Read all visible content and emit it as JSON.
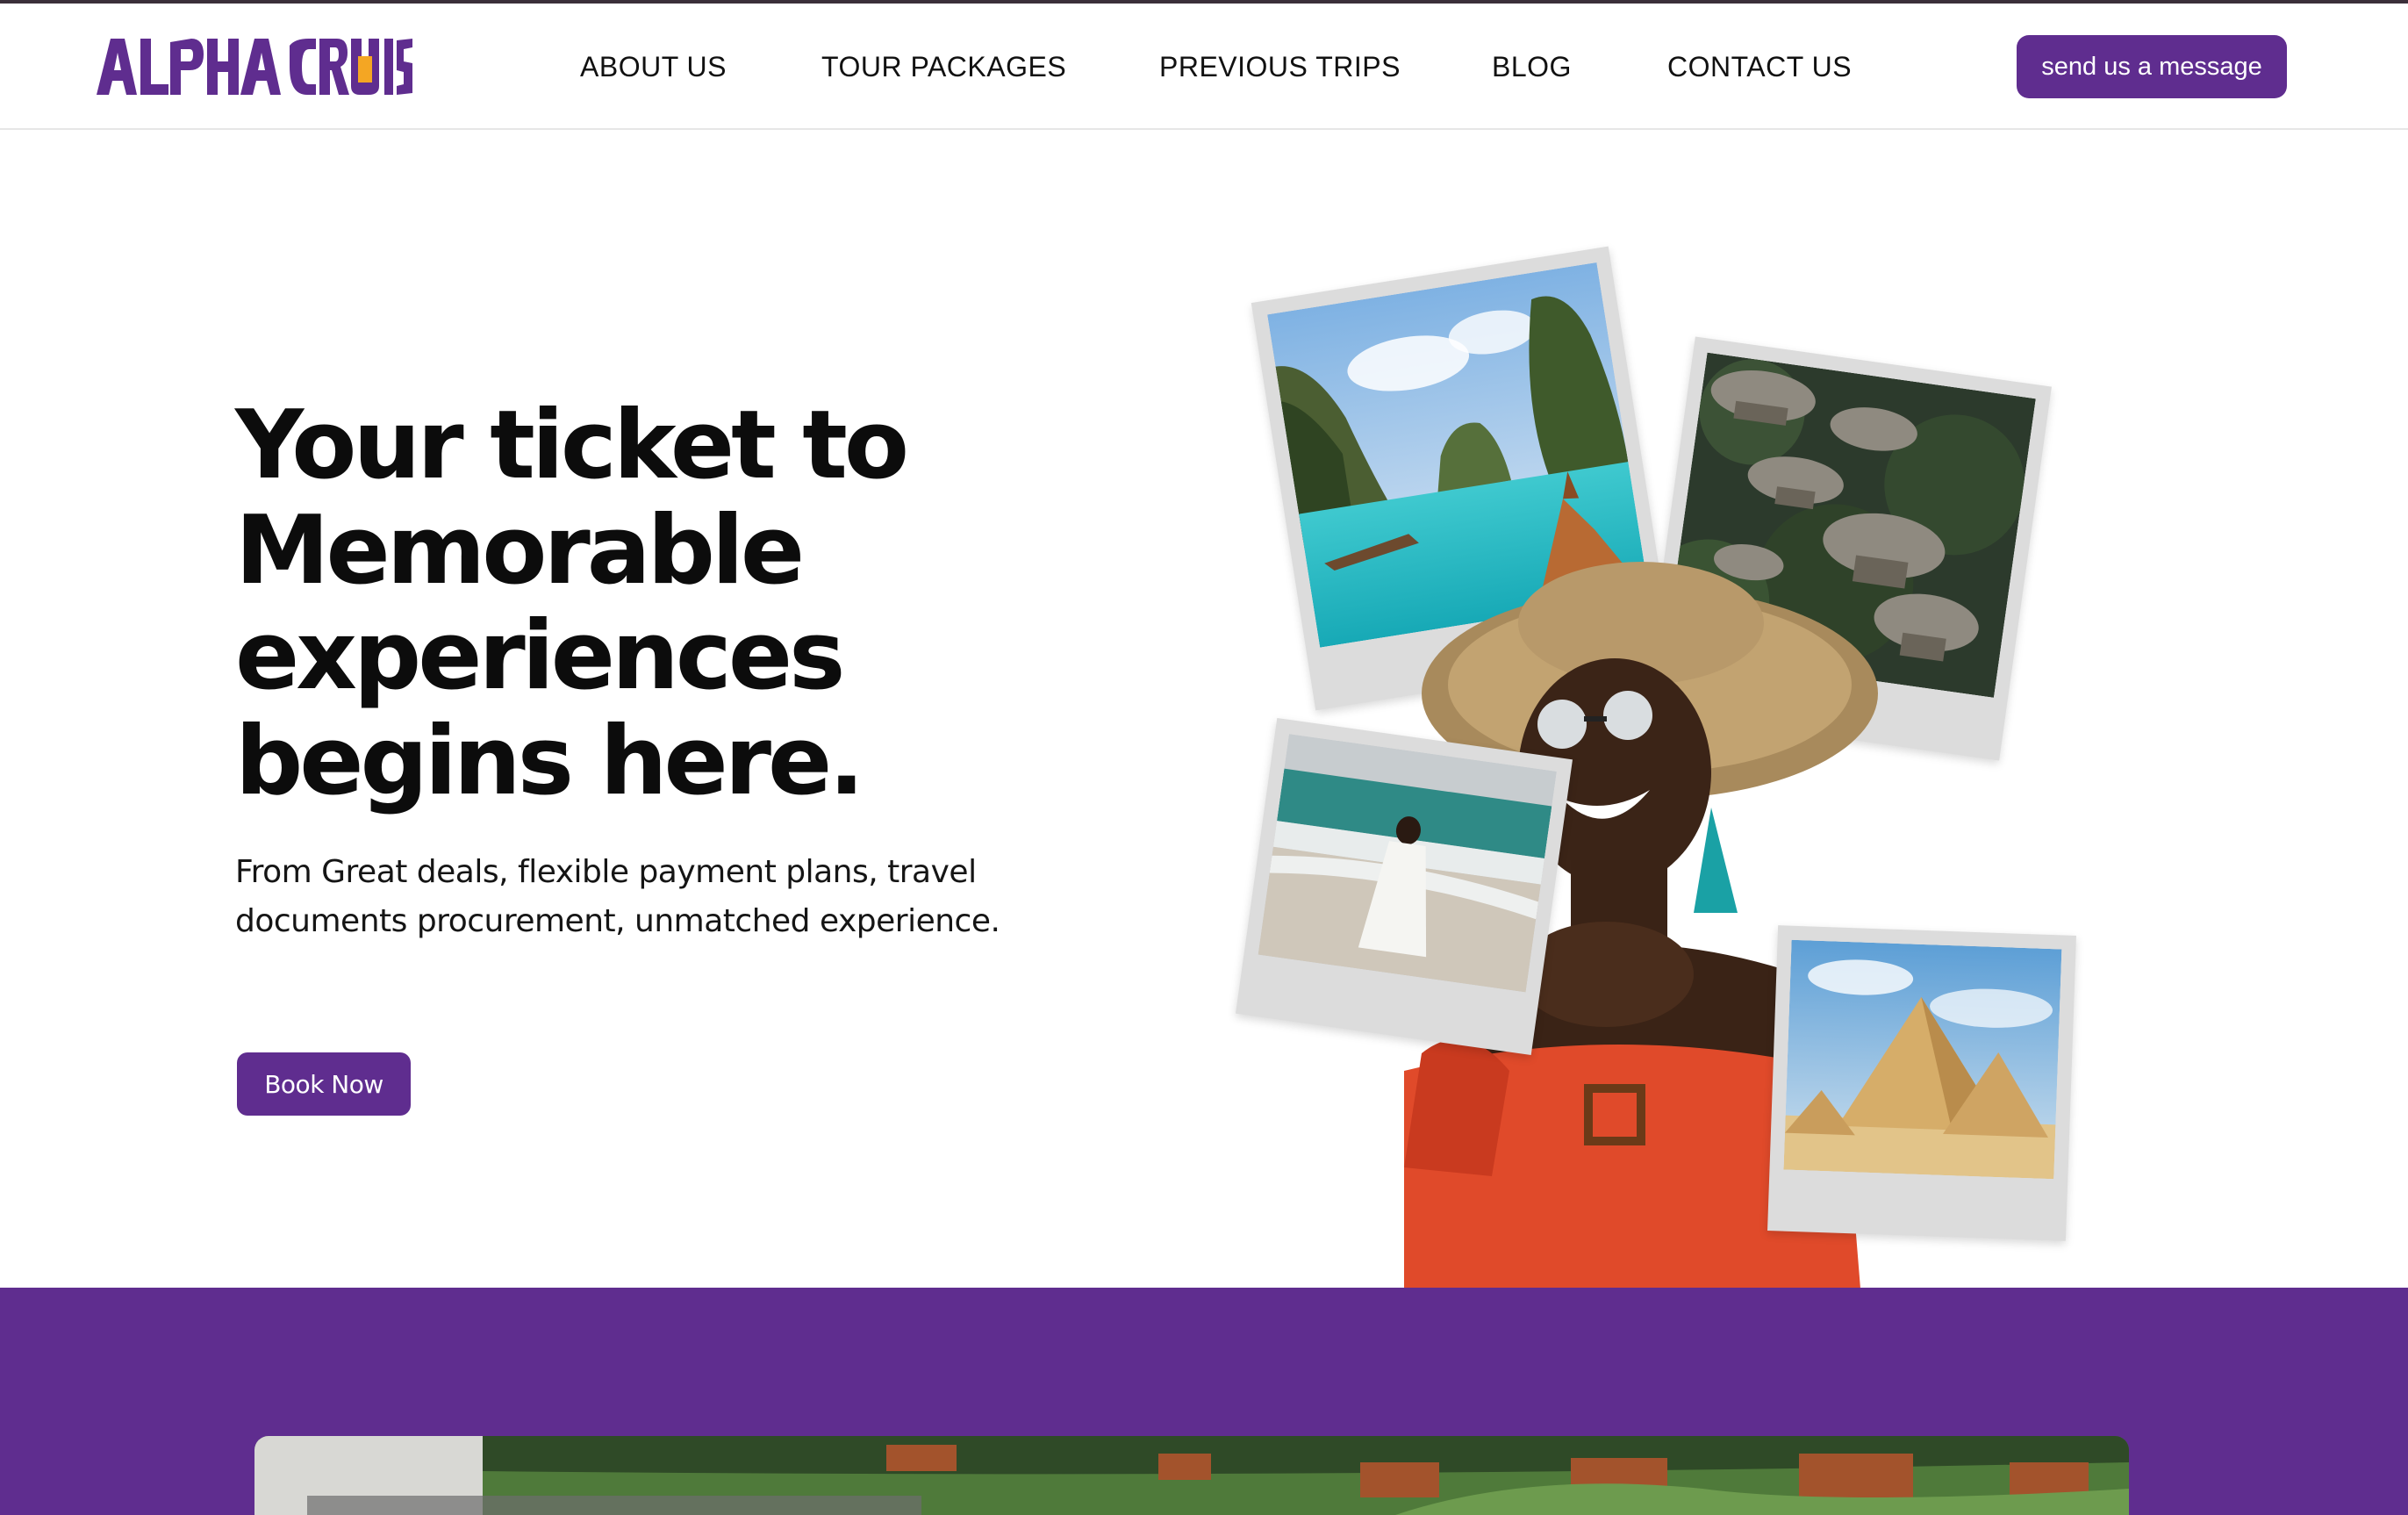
{
  "brand": {
    "logo_text": "ALPHA CRUISE",
    "accent_color": "#5f2d8f",
    "logo_accent_color": "#f4a623"
  },
  "nav": {
    "items": [
      "ABOUT US",
      "TOUR PACKAGES",
      "PREVIOUS TRIPS",
      "BLOG",
      "CONTACT US"
    ],
    "cta_label": "send us a message"
  },
  "hero": {
    "title": "Your ticket to Memorable experiences begins here.",
    "subtitle": "From Great deals, flexible payment plans, travel documents procurement, unmatched experience.",
    "cta_label": "Book Now"
  }
}
